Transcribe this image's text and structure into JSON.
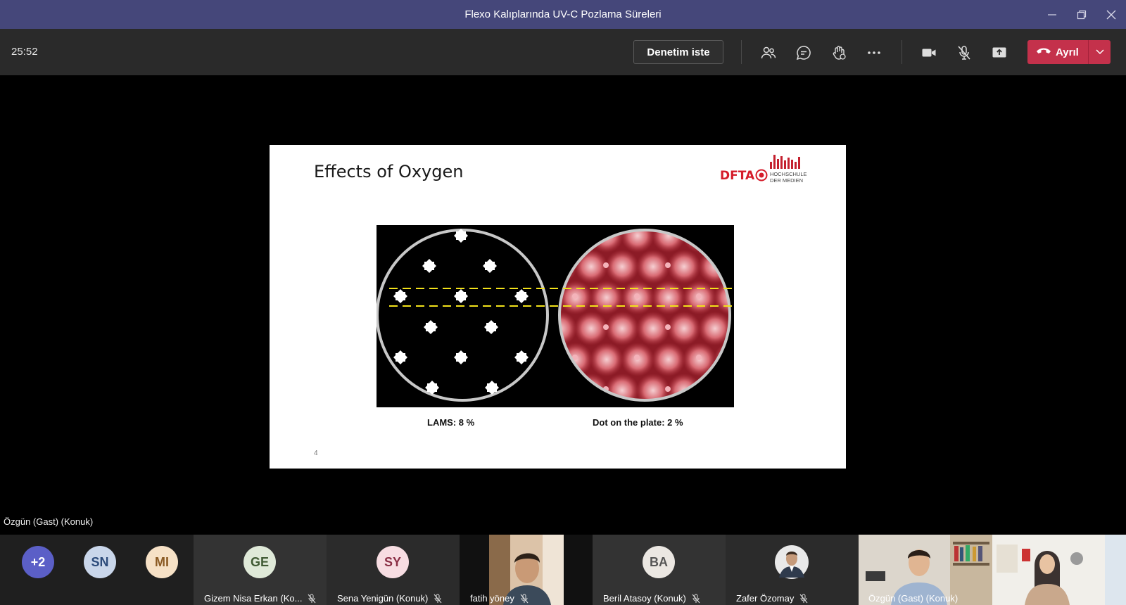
{
  "window": {
    "title": "Flexo Kalıplarında UV-C Pozlama Süreleri"
  },
  "toolbar": {
    "timer": "25:52",
    "request_control_label": "Denetim iste",
    "leave_label": "Ayrıl"
  },
  "slide": {
    "title": "Effects of Oxygen",
    "logo_text": "DFTA",
    "logo_sub_line1": "HOCHSCHULE",
    "logo_sub_line2": "DER MEDIEN",
    "caption_left": "LAMS: 8 %",
    "caption_right": "Dot on the plate: 2 %",
    "page_number": "4"
  },
  "speaker": {
    "name": "Özgün (Gast) (Konuk)"
  },
  "participants": [
    {
      "initials": "+2",
      "color": "#5b5fc7",
      "text_color": "#ffffff"
    },
    {
      "initials": "SN",
      "color": "#c9d6ea",
      "text_color": "#2b4a7a"
    },
    {
      "initials": "MI",
      "color": "#f6e1c6",
      "text_color": "#8a5a23"
    },
    {
      "initials": "GE",
      "color": "#dfe9d8",
      "text_color": "#3f5a33",
      "name": "Gizem Nisa Erkan (Ko..."
    },
    {
      "initials": "SY",
      "color": "#f7dde2",
      "text_color": "#8a2f45",
      "name": "Sena Yenigün (Konuk)"
    },
    {
      "name": "fatih yöney"
    },
    {
      "initials": "BA",
      "color": "#ebe7e2",
      "text_color": "#555555",
      "name": "Beril Atasoy (Konuk)"
    },
    {
      "name": "Zafer Özomay"
    },
    {
      "name": "Özgün (Gast) (Konuk)"
    }
  ]
}
